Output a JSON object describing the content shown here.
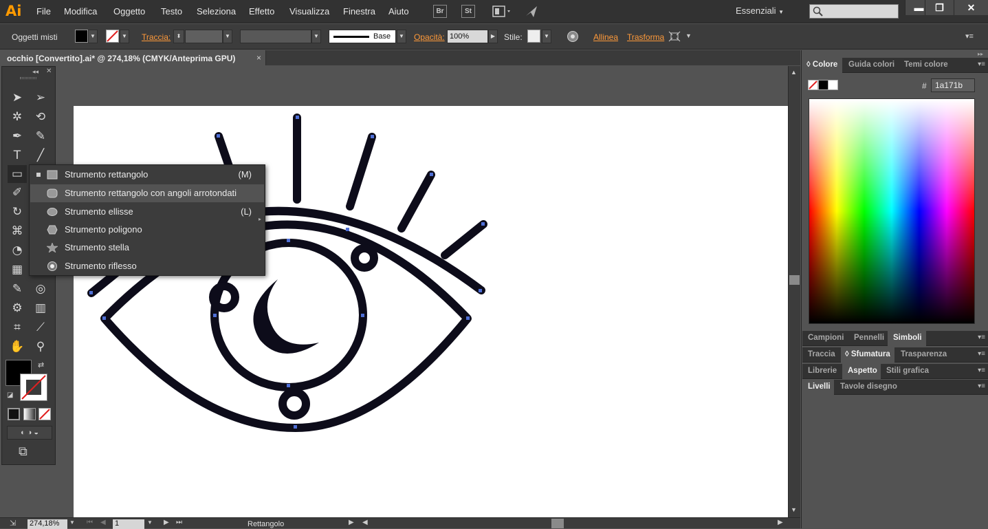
{
  "app": {
    "logo": "Ai",
    "menu": [
      "File",
      "Modifica",
      "Oggetto",
      "Testo",
      "Seleziona",
      "Effetto",
      "Visualizza",
      "Finestra",
      "Aiuto"
    ],
    "bridge_icon": "Br",
    "stock_icon": "St",
    "workspace": "Essenziali",
    "window_controls": [
      "minimize-icon",
      "restore-icon",
      "close-icon"
    ]
  },
  "control_bar": {
    "selection_label": "Oggetti misti",
    "stroke_label": "Traccia:",
    "brush_label": "Base",
    "opacity_label": "Opacità:",
    "opacity_value": "100%",
    "style_label": "Stile:",
    "align_link": "Allinea",
    "transform_link": "Trasforma"
  },
  "document": {
    "tab_title": "occhio [Convertito].ai* @ 274,18% (CMYK/Anteprima GPU)",
    "close_glyph": "×"
  },
  "flyout": {
    "items": [
      {
        "label": "Strumento rettangolo",
        "shortcut": "(M)",
        "icon": "rectangle-icon"
      },
      {
        "label": "Strumento rettangolo con angoli arrotondati",
        "shortcut": "",
        "icon": "rounded-rectangle-icon"
      },
      {
        "label": "Strumento ellisse",
        "shortcut": "(L)",
        "icon": "ellipse-icon"
      },
      {
        "label": "Strumento poligono",
        "shortcut": "",
        "icon": "polygon-icon"
      },
      {
        "label": "Strumento stella",
        "shortcut": "",
        "icon": "star-icon"
      },
      {
        "label": "Strumento riflesso",
        "shortcut": "",
        "icon": "flare-icon"
      }
    ]
  },
  "color_panel": {
    "tabs": [
      "Colore",
      "Guida colori",
      "Temi colore"
    ],
    "hex_label": "#",
    "hex_value": "1a171b"
  },
  "panels": {
    "row1": [
      "Campioni",
      "Pennelli",
      "Simboli"
    ],
    "row2": [
      "Traccia",
      "Sfumatura",
      "Trasparenza"
    ],
    "row3": [
      "Librerie",
      "Aspetto",
      "Stili grafica"
    ],
    "row4": [
      "Livelli",
      "Tavole disegno"
    ]
  },
  "status": {
    "zoom": "274,18%",
    "artboard_number": "1",
    "current_tool": "Rettangolo"
  },
  "colors": {
    "accent_orange": "#ff9a3a",
    "fill": "#000000",
    "art_stroke": "#0d0c1a",
    "anchor_blue": "#4f6fd6"
  }
}
